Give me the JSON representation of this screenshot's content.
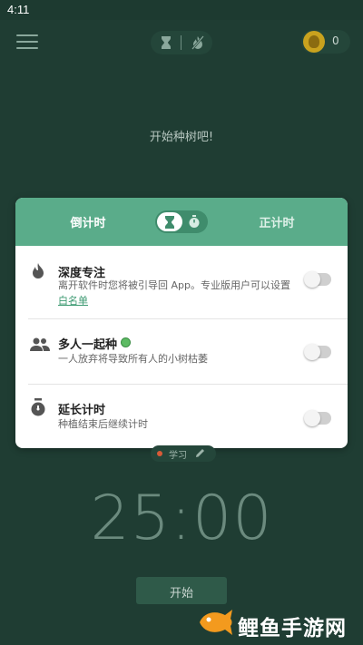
{
  "status_bar": {
    "time": "4:11"
  },
  "header": {
    "coin_count": "0",
    "mode_icons": [
      "hourglass-icon",
      "no-fire-icon"
    ]
  },
  "main": {
    "prompt": "开始种树吧!"
  },
  "dialog": {
    "tab_countdown": "倒计时",
    "tab_countup": "正计时",
    "toggle_state": "countdown",
    "rows": [
      {
        "title": "深度专注",
        "description": "离开软件时您将被引导回 App。专业版用户可以设置",
        "link": "白名单",
        "icon": "flame-icon",
        "enabled": false
      },
      {
        "title": "多人一起种",
        "description": "一人放弃将导致所有人的小树枯萎",
        "icon": "people-icon",
        "enabled": false
      },
      {
        "title": "延长计时",
        "description": "种植结束后继续计时",
        "icon": "stopwatch-icon",
        "enabled": false
      }
    ]
  },
  "tag": {
    "label": "学习",
    "color": "#d95a37"
  },
  "timer": {
    "value": "25:00"
  },
  "start_button": {
    "label": "开始"
  },
  "watermark": {
    "text": "鲤鱼手游网"
  },
  "colors": {
    "background": "#1f3d33",
    "accent": "#5aac8a",
    "link": "#3d9a72"
  }
}
